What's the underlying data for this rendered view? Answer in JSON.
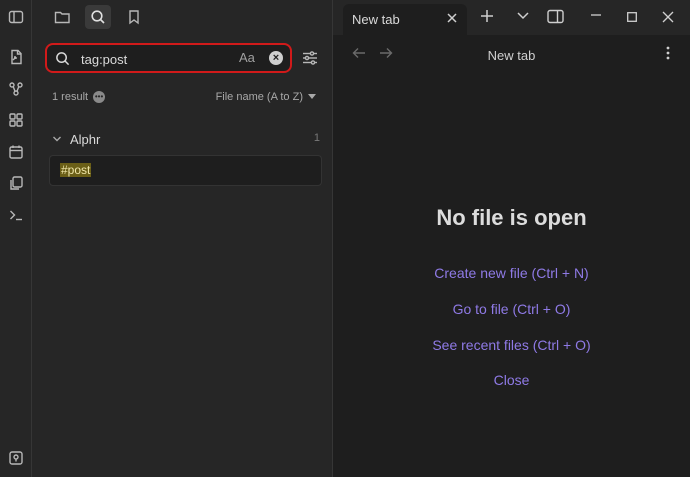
{
  "sidebar": {
    "search": {
      "value": "tag:post",
      "match_case": "Aa"
    },
    "result_count": "1 result",
    "sort_label": "File name (A to Z)",
    "group": {
      "name": "Alphr",
      "count": "1"
    },
    "match_text": "#post"
  },
  "tab": {
    "label": "New tab"
  },
  "view": {
    "title": "New tab",
    "empty_heading": "No file is open",
    "actions": [
      {
        "label": "Create new file (Ctrl + N)"
      },
      {
        "label": "Go to file (Ctrl + O)"
      },
      {
        "label": "See recent files (Ctrl + O)"
      },
      {
        "label": "Close"
      }
    ]
  },
  "colors": {
    "accent": "#8f7ae6",
    "highlight": "#6b5f17",
    "search_border": "#d11a1a"
  }
}
